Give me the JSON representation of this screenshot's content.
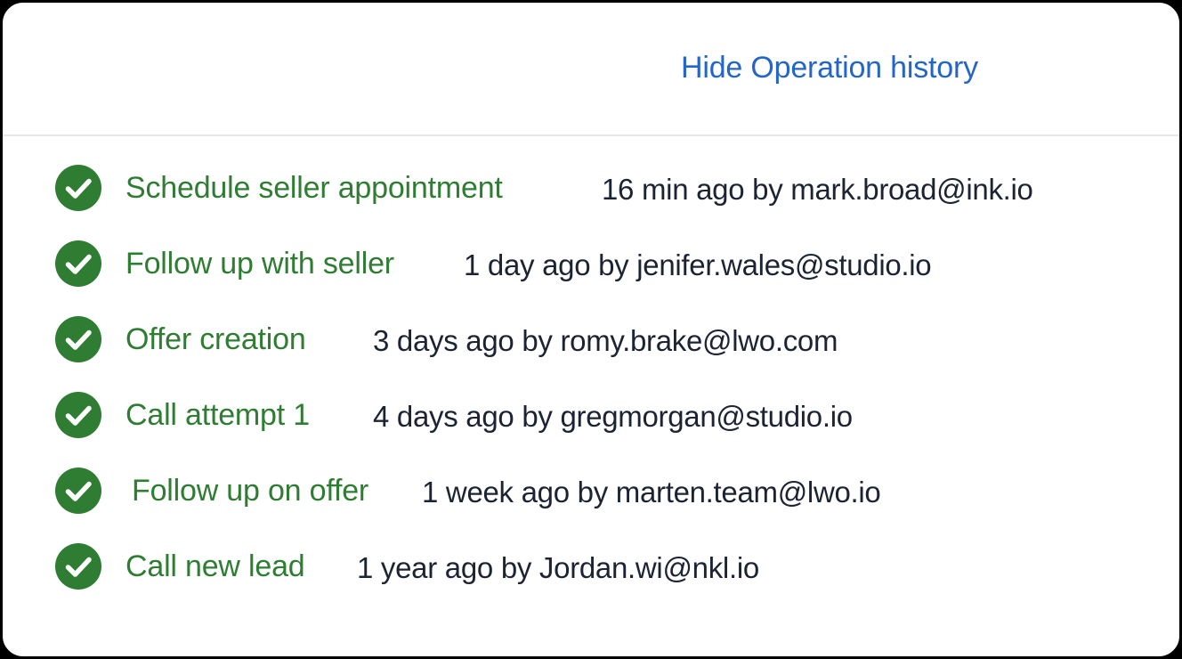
{
  "header": {
    "toggle_label": "Hide Operation history"
  },
  "colors": {
    "link": "#2466c8",
    "success_green": "#2e7d32",
    "meta_text": "#1c2333",
    "divider": "#e6e8ec"
  },
  "history": [
    {
      "icon": "check-circle-icon",
      "operation": "Schedule seller appointment",
      "meta": "16 min ago by mark.broad@ink.io"
    },
    {
      "icon": "check-circle-icon",
      "operation": "Follow up with seller",
      "meta": "1 day ago by jenifer.wales@studio.io"
    },
    {
      "icon": "check-circle-icon",
      "operation": "Offer creation",
      "meta": "3 days ago by romy.brake@lwo.com"
    },
    {
      "icon": "check-circle-icon",
      "operation": "Call attempt 1",
      "meta": "4 days ago by gregmorgan@studio.io"
    },
    {
      "icon": "check-circle-icon",
      "operation": "Follow up on offer",
      "meta": "1 week ago by marten.team@lwo.io"
    },
    {
      "icon": "check-circle-icon",
      "operation": "Call new lead",
      "meta": "1 year ago by Jordan.wi@nkl.io"
    }
  ]
}
